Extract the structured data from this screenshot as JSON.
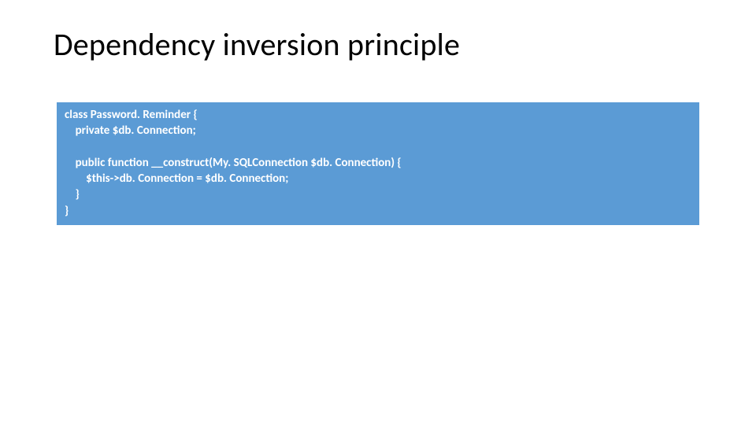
{
  "slide": {
    "title": "Dependency inversion principle",
    "code": {
      "l1": "class Password. Reminder {",
      "l2": "    private $db. Connection;",
      "l3": "",
      "l4": "    public function __construct(My. SQLConnection $db. Connection) {",
      "l5": "        $this->db. Connection = $db. Connection;",
      "l6": "    }",
      "l7": "}"
    }
  }
}
